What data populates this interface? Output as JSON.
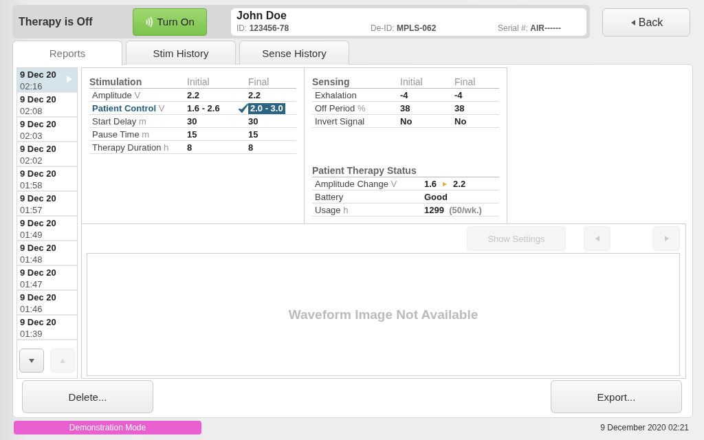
{
  "header": {
    "therapy_status": "Therapy is Off",
    "turn_on_button": "Turn On",
    "back_button": "Back"
  },
  "patient": {
    "name": "John Doe",
    "id": "ID: **123456-78**",
    "de_id": "De-ID: **MPLS-062**",
    "serial": "Serial #: **AIR------**"
  },
  "tabs": [
    {
      "label": "Reports",
      "selected": true
    },
    {
      "label": "Stim History",
      "selected": false
    },
    {
      "label": "Sense History",
      "selected": false
    }
  ],
  "reports": [
    {
      "date": "9 Dec 20",
      "time": "02:16",
      "selected": true
    },
    {
      "date": "9 Dec 20",
      "time": "02:08",
      "selected": false
    },
    {
      "date": "9 Dec 20",
      "time": "02:03",
      "selected": false
    },
    {
      "date": "9 Dec 20",
      "time": "02:02",
      "selected": false
    },
    {
      "date": "9 Dec 20",
      "time": "01:58",
      "selected": false
    },
    {
      "date": "9 Dec 20",
      "time": "01:57",
      "selected": false
    },
    {
      "date": "9 Dec 20",
      "time": "01:49",
      "selected": false
    },
    {
      "date": "9 Dec 20",
      "time": "01:48",
      "selected": false
    },
    {
      "date": "9 Dec 20",
      "time": "01:47",
      "selected": false
    },
    {
      "date": "9 Dec 20",
      "time": "01:46",
      "selected": false
    },
    {
      "date": "9 Dec 20",
      "time": "01:39",
      "selected": false
    }
  ],
  "list_buttons": [
    {
      "kind": "down",
      "disabled": false
    },
    {
      "kind": "up",
      "disabled": true
    }
  ],
  "stimulation": {
    "title": "Stimulation",
    "columns": [
      "Initial",
      "Final"
    ],
    "rows": [
      {
        "label": "Amplitude",
        "unit": "V",
        "initial": "2.2",
        "final": "2.2",
        "highlighted": false
      },
      {
        "label": "Patient Control",
        "unit": "V",
        "initial": "1.6 - 2.6",
        "final": "2.0 - 3.0",
        "highlighted": true
      },
      {
        "label": "Start Delay",
        "unit": "m",
        "initial": "30",
        "final": "30",
        "highlighted": false
      },
      {
        "label": "Pause Time",
        "unit": "m",
        "initial": "15",
        "final": "15",
        "highlighted": false
      },
      {
        "label": "Therapy Duration",
        "unit": "h",
        "initial": "8",
        "final": "8",
        "highlighted": false
      }
    ]
  },
  "sensing": {
    "title": "Sensing",
    "columns": [
      "Initial",
      "Final"
    ],
    "rows": [
      {
        "label": "Exhalation",
        "initial": "-4",
        "final": "-4",
        "highlighted": false
      },
      {
        "label": "Off Period",
        "unit": "%",
        "initial": "38",
        "final": "38",
        "highlighted": false
      },
      {
        "label": "Invert Signal",
        "initial": "No",
        "final": "No",
        "highlighted": false
      }
    ]
  },
  "therapy_status": {
    "title": "Patient Therapy Status",
    "rows": [
      {
        "kind": "change",
        "label": "Amplitude Change",
        "unit": "V",
        "from": "1.6",
        "to": "2.2"
      },
      {
        "kind": "value",
        "label": "Battery",
        "value": "Good"
      },
      {
        "kind": "value",
        "label": "Usage",
        "unit": "h",
        "value": "1299",
        "note": "(50/wk.)"
      }
    ]
  },
  "waveform": {
    "show_settings": {
      "label": "Show Settings",
      "disabled": true
    },
    "nav_buttons": [
      {
        "kind": "previous",
        "disabled": true
      },
      {
        "kind": "next",
        "disabled": true
      }
    ],
    "message": "Waveform Image Not Available"
  },
  "actions": [
    "Delete...",
    "Export..."
  ],
  "status_bar": {
    "mode": "Demonstration Mode",
    "datetime": "9 December 2020 02:21"
  }
}
